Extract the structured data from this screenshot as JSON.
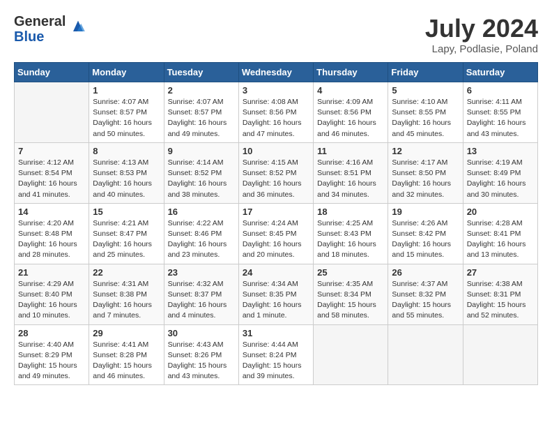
{
  "header": {
    "logo_general": "General",
    "logo_blue": "Blue",
    "title": "July 2024",
    "subtitle": "Lapy, Podlasie, Poland"
  },
  "calendar": {
    "days_of_week": [
      "Sunday",
      "Monday",
      "Tuesday",
      "Wednesday",
      "Thursday",
      "Friday",
      "Saturday"
    ],
    "weeks": [
      [
        {
          "day": "",
          "info": ""
        },
        {
          "day": "1",
          "info": "Sunrise: 4:07 AM\nSunset: 8:57 PM\nDaylight: 16 hours\nand 50 minutes."
        },
        {
          "day": "2",
          "info": "Sunrise: 4:07 AM\nSunset: 8:57 PM\nDaylight: 16 hours\nand 49 minutes."
        },
        {
          "day": "3",
          "info": "Sunrise: 4:08 AM\nSunset: 8:56 PM\nDaylight: 16 hours\nand 47 minutes."
        },
        {
          "day": "4",
          "info": "Sunrise: 4:09 AM\nSunset: 8:56 PM\nDaylight: 16 hours\nand 46 minutes."
        },
        {
          "day": "5",
          "info": "Sunrise: 4:10 AM\nSunset: 8:55 PM\nDaylight: 16 hours\nand 45 minutes."
        },
        {
          "day": "6",
          "info": "Sunrise: 4:11 AM\nSunset: 8:55 PM\nDaylight: 16 hours\nand 43 minutes."
        }
      ],
      [
        {
          "day": "7",
          "info": "Sunrise: 4:12 AM\nSunset: 8:54 PM\nDaylight: 16 hours\nand 41 minutes."
        },
        {
          "day": "8",
          "info": "Sunrise: 4:13 AM\nSunset: 8:53 PM\nDaylight: 16 hours\nand 40 minutes."
        },
        {
          "day": "9",
          "info": "Sunrise: 4:14 AM\nSunset: 8:52 PM\nDaylight: 16 hours\nand 38 minutes."
        },
        {
          "day": "10",
          "info": "Sunrise: 4:15 AM\nSunset: 8:52 PM\nDaylight: 16 hours\nand 36 minutes."
        },
        {
          "day": "11",
          "info": "Sunrise: 4:16 AM\nSunset: 8:51 PM\nDaylight: 16 hours\nand 34 minutes."
        },
        {
          "day": "12",
          "info": "Sunrise: 4:17 AM\nSunset: 8:50 PM\nDaylight: 16 hours\nand 32 minutes."
        },
        {
          "day": "13",
          "info": "Sunrise: 4:19 AM\nSunset: 8:49 PM\nDaylight: 16 hours\nand 30 minutes."
        }
      ],
      [
        {
          "day": "14",
          "info": "Sunrise: 4:20 AM\nSunset: 8:48 PM\nDaylight: 16 hours\nand 28 minutes."
        },
        {
          "day": "15",
          "info": "Sunrise: 4:21 AM\nSunset: 8:47 PM\nDaylight: 16 hours\nand 25 minutes."
        },
        {
          "day": "16",
          "info": "Sunrise: 4:22 AM\nSunset: 8:46 PM\nDaylight: 16 hours\nand 23 minutes."
        },
        {
          "day": "17",
          "info": "Sunrise: 4:24 AM\nSunset: 8:45 PM\nDaylight: 16 hours\nand 20 minutes."
        },
        {
          "day": "18",
          "info": "Sunrise: 4:25 AM\nSunset: 8:43 PM\nDaylight: 16 hours\nand 18 minutes."
        },
        {
          "day": "19",
          "info": "Sunrise: 4:26 AM\nSunset: 8:42 PM\nDaylight: 16 hours\nand 15 minutes."
        },
        {
          "day": "20",
          "info": "Sunrise: 4:28 AM\nSunset: 8:41 PM\nDaylight: 16 hours\nand 13 minutes."
        }
      ],
      [
        {
          "day": "21",
          "info": "Sunrise: 4:29 AM\nSunset: 8:40 PM\nDaylight: 16 hours\nand 10 minutes."
        },
        {
          "day": "22",
          "info": "Sunrise: 4:31 AM\nSunset: 8:38 PM\nDaylight: 16 hours\nand 7 minutes."
        },
        {
          "day": "23",
          "info": "Sunrise: 4:32 AM\nSunset: 8:37 PM\nDaylight: 16 hours\nand 4 minutes."
        },
        {
          "day": "24",
          "info": "Sunrise: 4:34 AM\nSunset: 8:35 PM\nDaylight: 16 hours\nand 1 minute."
        },
        {
          "day": "25",
          "info": "Sunrise: 4:35 AM\nSunset: 8:34 PM\nDaylight: 15 hours\nand 58 minutes."
        },
        {
          "day": "26",
          "info": "Sunrise: 4:37 AM\nSunset: 8:32 PM\nDaylight: 15 hours\nand 55 minutes."
        },
        {
          "day": "27",
          "info": "Sunrise: 4:38 AM\nSunset: 8:31 PM\nDaylight: 15 hours\nand 52 minutes."
        }
      ],
      [
        {
          "day": "28",
          "info": "Sunrise: 4:40 AM\nSunset: 8:29 PM\nDaylight: 15 hours\nand 49 minutes."
        },
        {
          "day": "29",
          "info": "Sunrise: 4:41 AM\nSunset: 8:28 PM\nDaylight: 15 hours\nand 46 minutes."
        },
        {
          "day": "30",
          "info": "Sunrise: 4:43 AM\nSunset: 8:26 PM\nDaylight: 15 hours\nand 43 minutes."
        },
        {
          "day": "31",
          "info": "Sunrise: 4:44 AM\nSunset: 8:24 PM\nDaylight: 15 hours\nand 39 minutes."
        },
        {
          "day": "",
          "info": ""
        },
        {
          "day": "",
          "info": ""
        },
        {
          "day": "",
          "info": ""
        }
      ]
    ]
  }
}
